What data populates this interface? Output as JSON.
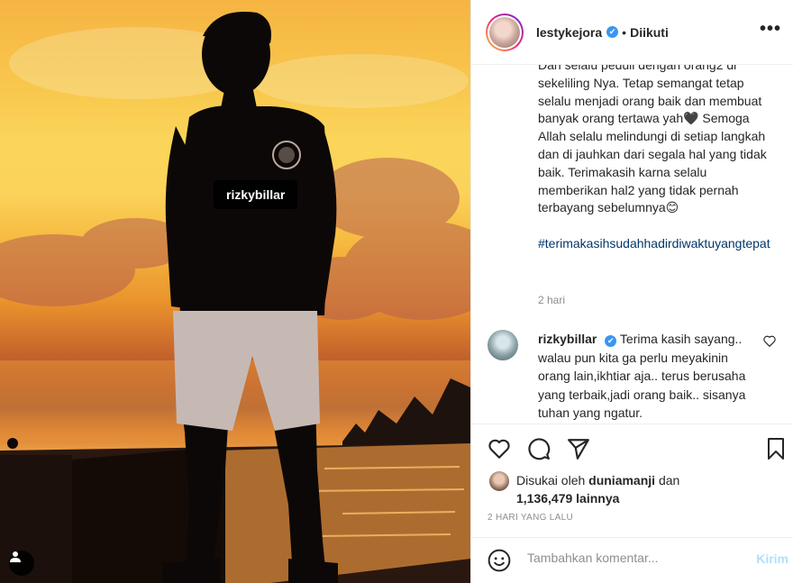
{
  "photo": {
    "tag_label": "rizkybillar",
    "tag_button_icon": "user-tag-icon"
  },
  "header": {
    "username": "lestykejora",
    "verified_mark": "✔",
    "separator": "•",
    "follow_label": "Diikuti",
    "more_icon": "more-options-icon",
    "more_label": "•••"
  },
  "caption": {
    "text": "Dan selalu peduli dengan orang2 di sekeliling Nya. Tetap semangat tetap selalu menjadi orang baik dan membuat banyak orang tertawa yah🖤 Semoga Allah selalu melindungi di setiap langkah dan di jauhkan dari segala hal yang tidak baik. Terimakasih karna selalu memberikan hal2 yang tidak pernah terbayang sebelumnya😊",
    "hashtag": "#terimakasihsudahhadirdiwaktuyangtepat",
    "time": "2 hari"
  },
  "reply": {
    "username": "rizkybillar",
    "text": "Terima kasih sayang.. walau pun kita ga perlu meyakinin orang lain,ikhtiar aja.. terus berusaha yang terbaik,jadi orang baik.. sisanya tuhan yang ngatur.",
    "like_icon": "heart-outline-icon"
  },
  "actions": {
    "icons": [
      "heart-icon",
      "comment-icon",
      "share-icon",
      "bookmark-icon"
    ]
  },
  "likes": {
    "prefix": "Disukai oleh",
    "user": "duniamanji",
    "conj": "dan",
    "count": "1,136,479 lainnya"
  },
  "date": "2 HARI YANG LALU",
  "comment_box": {
    "placeholder": "Tambahkan komentar...",
    "post_label": "Kirim",
    "emoji_icon": "emoji-icon"
  },
  "colors": {
    "accent": "#3897f0",
    "post_disabled": "#b2dffc",
    "hashtag": "#00376b",
    "muted": "#8e8e8e"
  }
}
